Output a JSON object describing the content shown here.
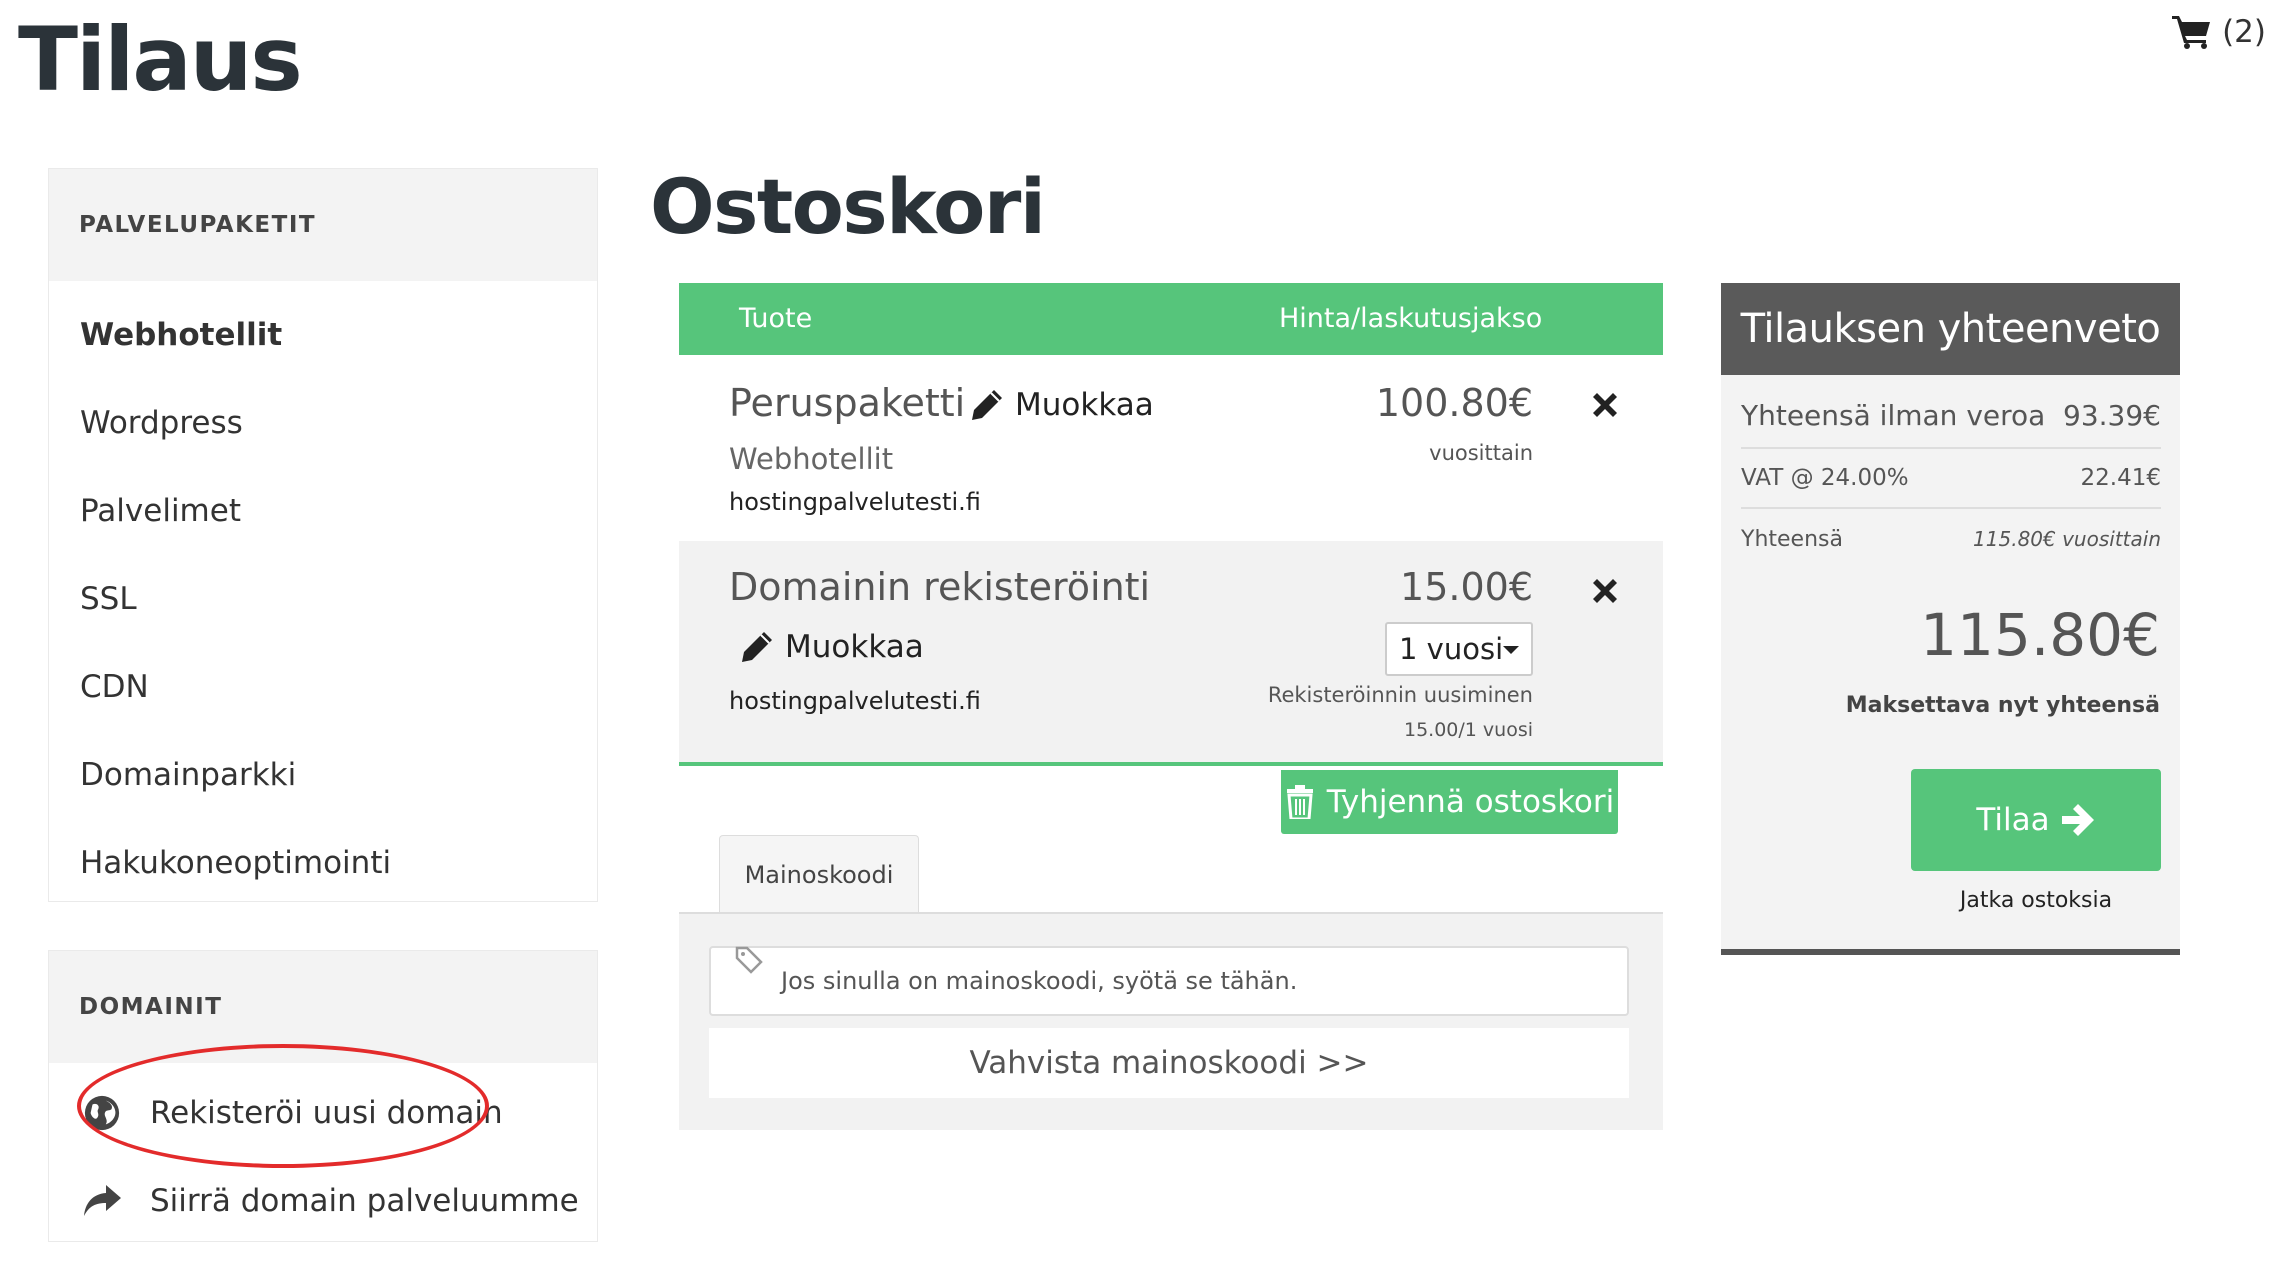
{
  "page": {
    "title": "Tilaus"
  },
  "cart_indicator": {
    "icon": "shopping-cart-icon",
    "count": "(2)"
  },
  "sidebar": {
    "packages": {
      "heading": "PALVELUPAKETIT",
      "items": [
        {
          "label": "Webhotellit",
          "active": true
        },
        {
          "label": "Wordpress"
        },
        {
          "label": "Palvelimet"
        },
        {
          "label": "SSL"
        },
        {
          "label": "CDN"
        },
        {
          "label": "Domainparkki"
        },
        {
          "label": "Hakukoneoptimointi"
        }
      ]
    },
    "domains": {
      "heading": "DOMAINIT",
      "items": [
        {
          "label": "Rekisteröi uusi domain",
          "icon": "globe-icon"
        },
        {
          "label": "Siirrä domain palveluumme",
          "icon": "share-arrow-icon"
        }
      ]
    }
  },
  "cart": {
    "title": "Ostoskori",
    "columns": {
      "product": "Tuote",
      "price": "Hinta/laskutusjakso"
    },
    "items": [
      {
        "name": "Peruspaketti",
        "edit_label": "Muokkaa",
        "group": "Webhotellit",
        "domain": "hostingpalvelutesti.fi",
        "price": "100.80€",
        "cycle": "vuosittain"
      },
      {
        "name": "Domainin rekisteröinti",
        "edit_label": "Muokkaa",
        "domain": "hostingpalvelutesti.fi",
        "price": "15.00€",
        "period_selected": "1 vuosi",
        "renewal_label": "Rekisteröinnin uusiminen",
        "renewal_price": "15.00/1 vuosi"
      }
    ],
    "clear_label": "Tyhjennä ostoskori",
    "promo": {
      "tab_label": "Mainoskoodi",
      "placeholder": "Jos sinulla on mainoskoodi, syötä se tähän.",
      "validate_label": "Vahvista mainoskoodi >>"
    }
  },
  "summary": {
    "title": "Tilauksen yhteenveto",
    "subtotal_label": "Yhteensä ilman veroa",
    "subtotal_value": "93.39€",
    "vat_label": "VAT @ 24.00%",
    "vat_value": "22.41€",
    "total_label": "Yhteensä",
    "total_recurring": "115.80€ vuosittain",
    "due_today": "115.80€",
    "due_today_label": "Maksettava nyt yhteensä",
    "order_label": "Tilaa",
    "continue_label": "Jatka ostoksia"
  },
  "colors": {
    "accent_green": "#56c57b",
    "summary_header": "#5a5a5a",
    "highlight_red": "#e32b2b"
  }
}
